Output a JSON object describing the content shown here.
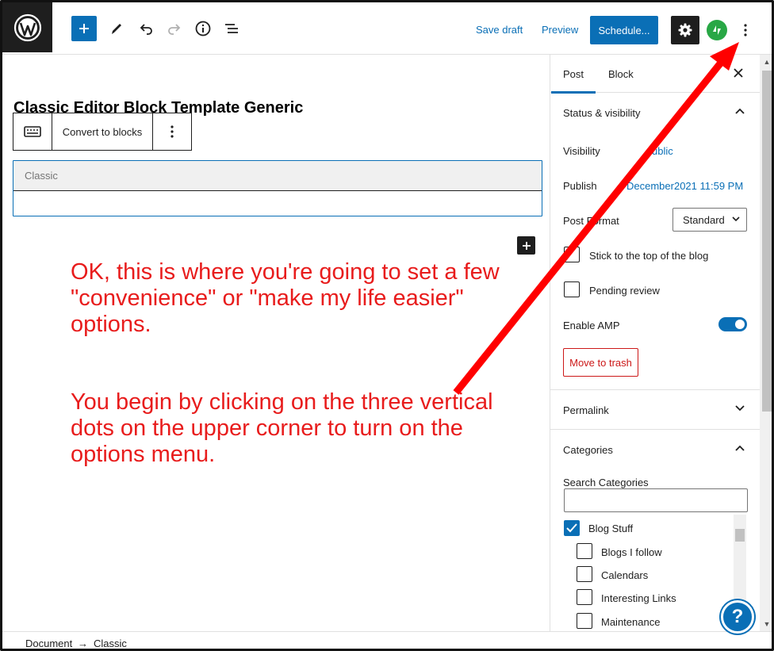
{
  "toolbar": {
    "save_draft": "Save draft",
    "preview": "Preview",
    "schedule": "Schedule..."
  },
  "post": {
    "title": "Classic Editor Block Template Generic"
  },
  "block_toolbar": {
    "convert_label": "Convert to blocks"
  },
  "classic_block": {
    "label": "Classic"
  },
  "annotation": {
    "paragraph1": "OK, this is where you're going to set a few \"convenience\" or \"make my life easier\" options.",
    "paragraph2": "You begin by clicking on the three vertical dots on the upper corner to turn on the options menu.",
    "color": "#e81c1c"
  },
  "sidebar": {
    "tabs": [
      "Post",
      "Block"
    ],
    "active_tab": "Post",
    "status_section": "Status & visibility",
    "visibility_label": "Visibility",
    "visibility_value": "ublic",
    "publish_label": "Publish",
    "publish_value": "December2021 11:59 PM",
    "format_label": "Post Format",
    "format_value": "Standard",
    "stick_label": "Stick to the top of the blog",
    "pending_label": "Pending review",
    "amp_label": "Enable AMP",
    "amp_enabled": true,
    "trash_label": "Move to trash",
    "permalink_section": "Permalink",
    "categories_section": "Categories",
    "search_label": "Search Categories",
    "categories": [
      {
        "name": "Blog Stuff",
        "checked": true
      },
      {
        "name": "Blogs I follow",
        "checked": false
      },
      {
        "name": "Calendars",
        "checked": false
      },
      {
        "name": "Interesting Links",
        "checked": false
      },
      {
        "name": "Maintenance",
        "checked": false
      }
    ]
  },
  "footer": {
    "crumb_document": "Document",
    "crumb_sep": "→",
    "crumb_classic": "Classic"
  },
  "colors": {
    "accent": "#0a6fb6",
    "dark": "#1e1e1e",
    "danger": "#cc1818",
    "jetpack": "#28a745"
  }
}
